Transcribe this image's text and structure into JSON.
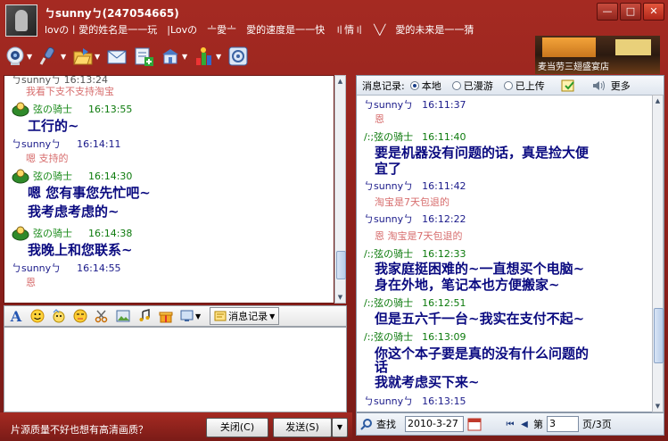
{
  "window": {
    "title": "ㄅsunnyㄅ(247054665)",
    "signature": "lovの〡愛的姓名是一一玩　|Lovの　〦愛〦　愛的速度是一一快　〢情〢　╲╱　愛的未来是一一猜",
    "btn_min": "—",
    "btn_max": "□",
    "btn_close": "✕"
  },
  "ad": {
    "text": "麦当劳三翅盛宴店"
  },
  "toolbar": {
    "items": [
      "video-call",
      "voice-call",
      "send-file",
      "send-email",
      "apply",
      "tools",
      "games",
      "settings"
    ]
  },
  "left_chat": {
    "cut_top": "ㄅsunnyㄅ  16:13:24",
    "m1_text": "我看下支不支持淘宝",
    "m2_nick": "弦の骑士",
    "m2_time": "16:13:55",
    "m2_text": "工行的~",
    "m3_nick": "ㄅsunnyㄅ",
    "m3_time": "16:14:11",
    "m3_text": "嗯 支持的",
    "m4_nick": "弦の骑士",
    "m4_time": "16:14:30",
    "m4_text1": "嗯 您有事您先忙吧~",
    "m4_text2": "我考虑考虑的~",
    "m5_nick": "弦の骑士",
    "m5_time": "16:14:38",
    "m5_text": "我晚上和您联系~",
    "m6_nick": "ㄅsunnyㄅ",
    "m6_time": "16:14:55",
    "m6_text": "恩"
  },
  "format_bar": {
    "font_icon": "A",
    "msg_record_label": "消息记录"
  },
  "input_bar": {
    "ad_text": "片源质量不好也想有高清画质？",
    "close_label": "关闭(C)",
    "send_label": "发送(S)",
    "send_arrow": "▼"
  },
  "history": {
    "header_label": "消息记录:",
    "opt_local": "本地",
    "opt_roam": "已漫游",
    "opt_upload": "已上传",
    "more_label": "更多",
    "r1_nick": "ㄅsunnyㄅ",
    "r1_time": "16:11:37",
    "r1_text": "恩",
    "r2_nick": "/:;弦の骑士",
    "r2_time": "16:11:40",
    "r2_text1": "要是机器没有问题的话，真是捡大便",
    "r2_text2": "宜了",
    "r3_nick": "ㄅsunnyㄅ",
    "r3_time": "16:11:42",
    "r3_text": "淘宝是7天包退的",
    "r4_nick": "ㄅsunnyㄅ",
    "r4_time": "16:12:22",
    "r4_text": "恩 淘宝是7天包退的",
    "r5_nick": "/:;弦の骑士",
    "r5_time": "16:12:33",
    "r5_text1": "我家庭挺困难的~一直想买个电脑~",
    "r5_text2": "身在外地，笔记本也方便搬家~",
    "r6_nick": "/:;弦の骑士",
    "r6_time": "16:12:51",
    "r6_text": "但是五六千一台~我实在支付不起~",
    "r7_nick": "/:;弦の骑士",
    "r7_time": "16:13:09",
    "r7_text1": "你这个本子要是真的没有什么问题的",
    "r7_text2": "话",
    "r7_text3": "我就考虑买下来~",
    "r8_nick": "ㄅsunnyㄅ",
    "r8_time": "16:13:15"
  },
  "history_bottom": {
    "find_label": "查找",
    "date": "2010-3-27",
    "page_prefix": "第",
    "page_value": "3",
    "page_suffix": "页/3页"
  }
}
